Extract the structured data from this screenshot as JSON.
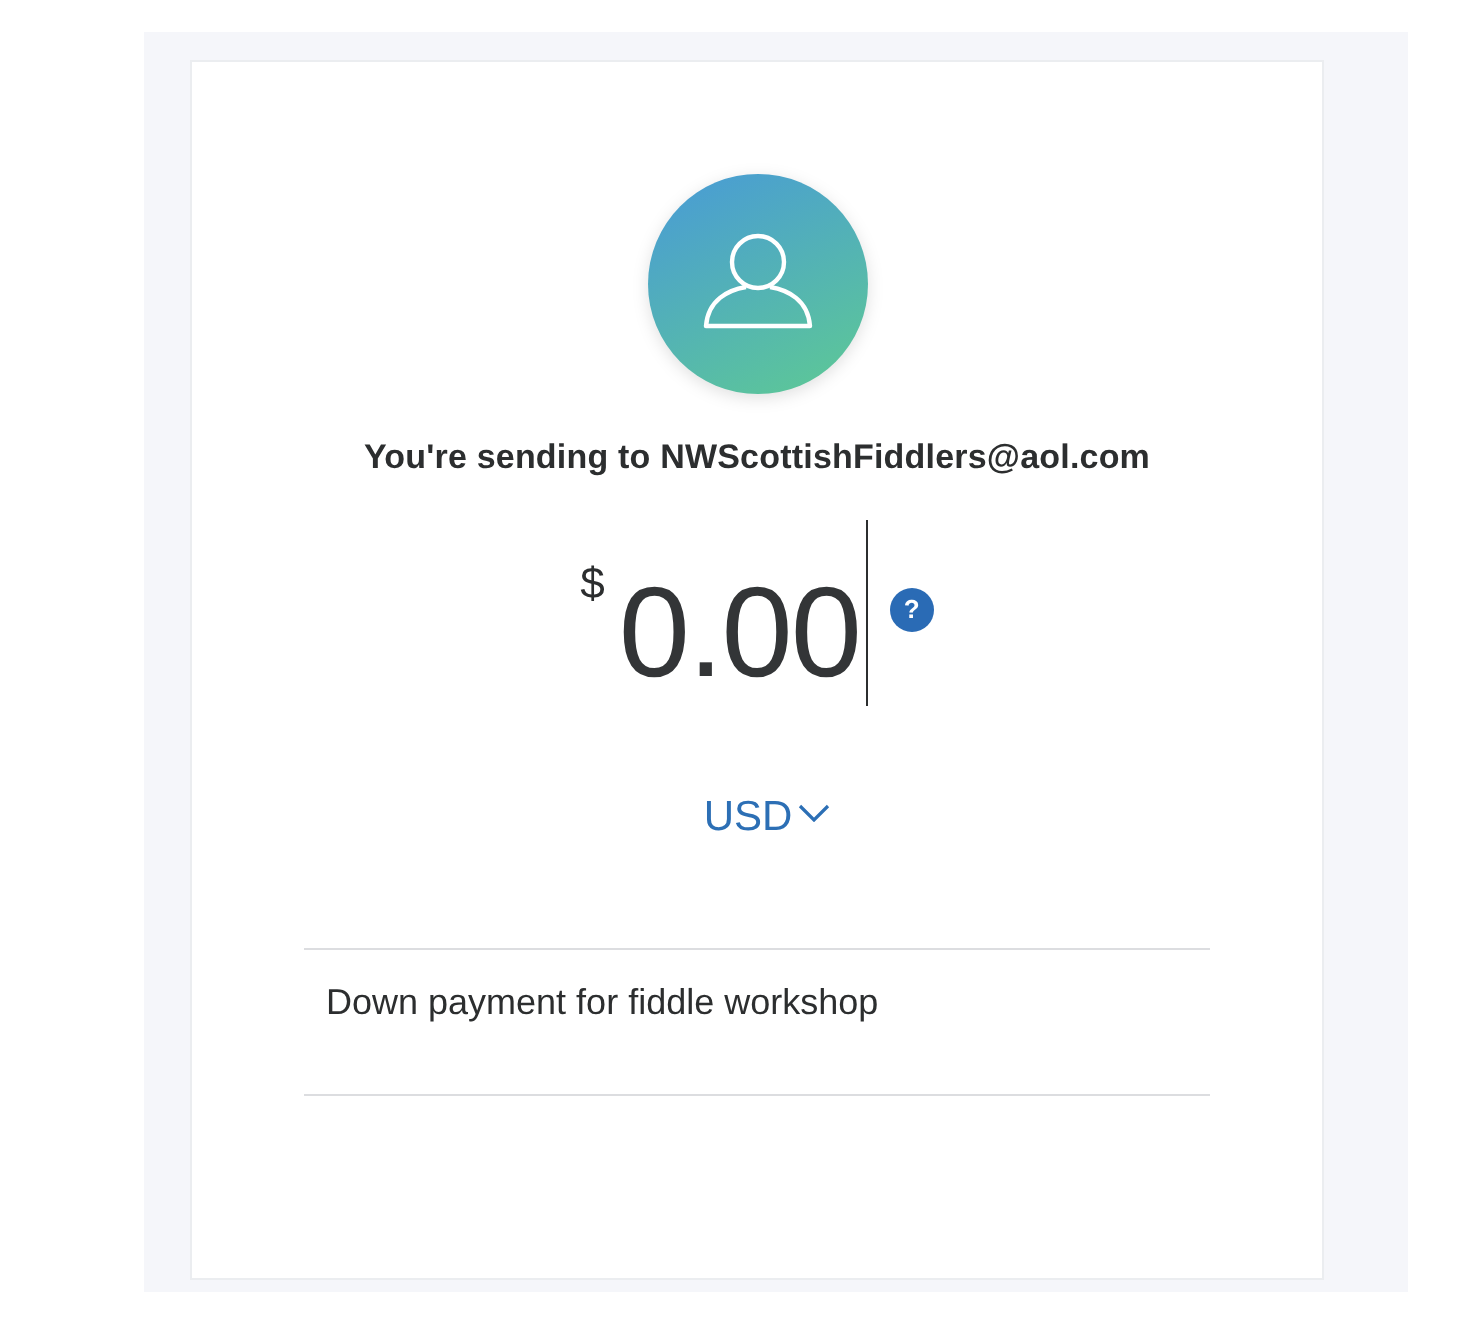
{
  "recipient_line": "You're sending to NWScottishFiddlers@aol.com",
  "amount": {
    "currency_symbol": "$",
    "value": "0.00",
    "focused": true
  },
  "help_button": {
    "label": "?"
  },
  "currency": {
    "code": "USD"
  },
  "note": {
    "value": "Down payment for fiddle workshop"
  }
}
